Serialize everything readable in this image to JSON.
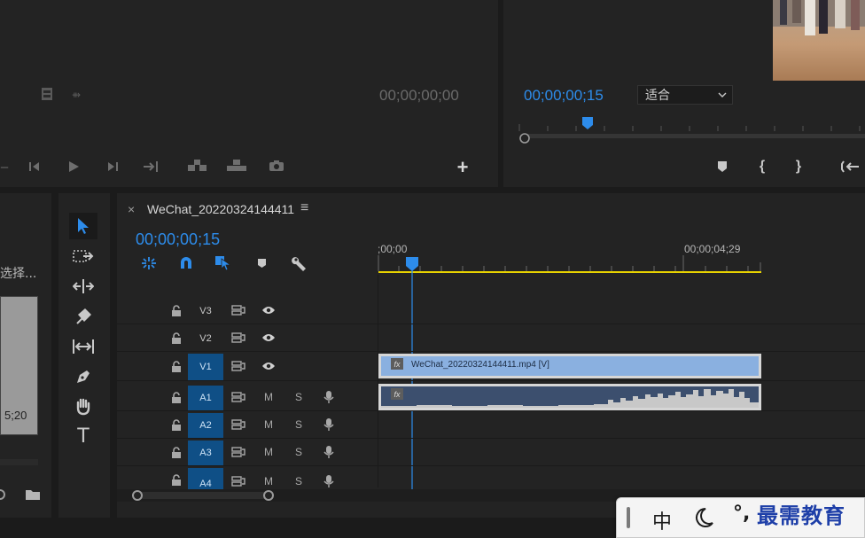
{
  "source_monitor": {
    "timecode": "00;00;00;00"
  },
  "program_monitor": {
    "timecode": "00;00;00;15",
    "fit_select": "适合"
  },
  "left_panel": {
    "label": "选择...",
    "timecode_fragment": "5;20"
  },
  "timeline": {
    "close_glyph": "×",
    "sequence_name": "WeChat_20220324144411",
    "menu_glyph": "≡",
    "timecode": "00;00;00;15",
    "ruler_start": ";00;00",
    "ruler_end": "00;00;04;29",
    "video_tracks": [
      {
        "name": "V3",
        "targeted": false
      },
      {
        "name": "V2",
        "targeted": false
      },
      {
        "name": "V1",
        "targeted": true
      }
    ],
    "audio_tracks": [
      {
        "name": "A1",
        "mute": "M",
        "solo": "S"
      },
      {
        "name": "A2",
        "mute": "M",
        "solo": "S"
      },
      {
        "name": "A3",
        "mute": "M",
        "solo": "S"
      },
      {
        "name": "A4",
        "mute": "M",
        "solo": "S"
      }
    ],
    "video_clip": {
      "fx": "fx",
      "label": "WeChat_20220324144411.mp4 [V]",
      "color": "#8ab0e0"
    },
    "audio_clip": {
      "fx": "fx",
      "color": "#3c4f6e"
    }
  },
  "ime_bar": {
    "chinese": "中",
    "punctuation": "°,",
    "watermark": "最需教育"
  },
  "colors": {
    "accent_blue": "#2d8ceb",
    "work_area_yellow": "#e8d300",
    "track_target_blue": "#0f4f86"
  }
}
